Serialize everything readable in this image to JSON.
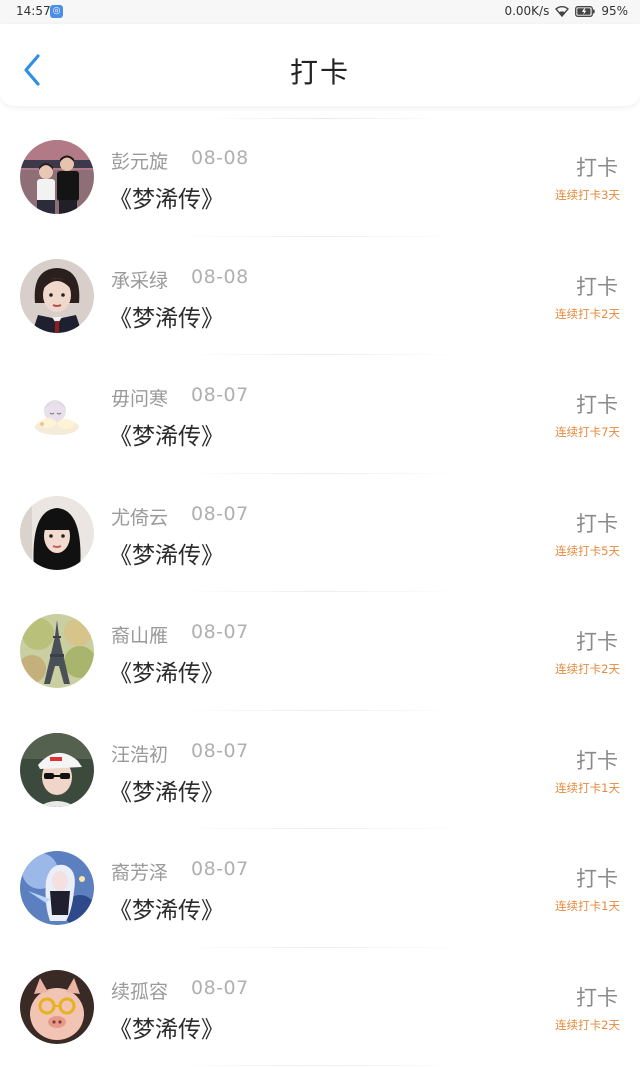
{
  "status_bar": {
    "time": "14:57",
    "network_speed": "0.00K/s",
    "battery": "95%"
  },
  "header": {
    "title": "打卡"
  },
  "colors": {
    "accent": "#2d8fe6",
    "streak": "#e58a3c"
  },
  "items": [
    {
      "name": "彭元旋",
      "date": "08-08",
      "book": "《梦浠传》",
      "action": "打卡",
      "streak": "连续打卡3天",
      "avatar": "couple-photo"
    },
    {
      "name": "承采绿",
      "date": "08-08",
      "book": "《梦浠传》",
      "action": "打卡",
      "streak": "连续打卡2天",
      "avatar": "girl-portrait"
    },
    {
      "name": "毋问寒",
      "date": "08-07",
      "book": "《梦浠传》",
      "action": "打卡",
      "streak": "连续打卡7天",
      "avatar": "cartoon-sleeping"
    },
    {
      "name": "尤倚云",
      "date": "08-07",
      "book": "《梦浠传》",
      "action": "打卡",
      "streak": "连续打卡5天",
      "avatar": "girl-bangs"
    },
    {
      "name": "裔山雁",
      "date": "08-07",
      "book": "《梦浠传》",
      "action": "打卡",
      "streak": "连续打卡2天",
      "avatar": "eiffel-tower"
    },
    {
      "name": "汪浩初",
      "date": "08-07",
      "book": "《梦浠传》",
      "action": "打卡",
      "streak": "连续打卡1天",
      "avatar": "boy-cap"
    },
    {
      "name": "裔芳泽",
      "date": "08-07",
      "book": "《梦浠传》",
      "action": "打卡",
      "streak": "连续打卡1天",
      "avatar": "anime-girl"
    },
    {
      "name": "续孤容",
      "date": "08-07",
      "book": "《梦浠传》",
      "action": "打卡",
      "streak": "连续打卡2天",
      "avatar": "pig-glasses"
    }
  ]
}
